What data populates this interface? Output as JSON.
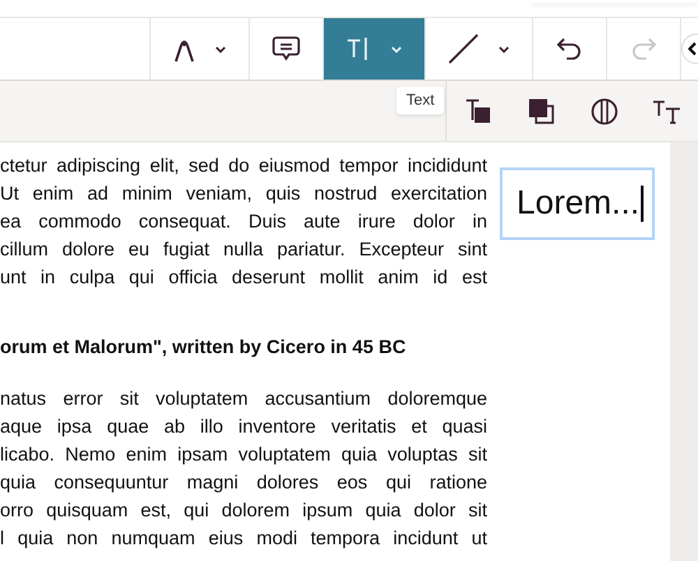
{
  "toolbar": {
    "tools": [
      {
        "kind": "pen",
        "has_caret": true,
        "selected": false,
        "disabled": false
      },
      {
        "kind": "comment",
        "has_caret": false,
        "selected": false,
        "disabled": false
      },
      {
        "kind": "text",
        "has_caret": true,
        "selected": true,
        "disabled": false
      },
      {
        "kind": "line",
        "has_caret": true,
        "selected": false,
        "disabled": false
      },
      {
        "kind": "undo",
        "has_caret": false,
        "selected": false,
        "disabled": false
      },
      {
        "kind": "redo",
        "has_caret": false,
        "selected": false,
        "disabled": true
      }
    ]
  },
  "tooltip": {
    "text": "Text"
  },
  "format_tools": [
    {
      "kind": "text-background"
    },
    {
      "kind": "fill"
    },
    {
      "kind": "contrast"
    },
    {
      "kind": "text-size"
    }
  ],
  "document": {
    "paragraph_1": [
      "ctetur adipiscing elit, sed do eiusmod tempor incididunt",
      "Ut enim ad minim veniam, quis nostrud exercitation",
      "ea commodo consequat. Duis aute irure dolor in",
      "cillum dolore eu fugiat nulla pariatur. Excepteur sint",
      "unt in culpa qui officia deserunt mollit anim id est"
    ],
    "heading": "orum et Malorum\", written by Cicero in 45 BC",
    "paragraph_2": [
      "natus error sit voluptatem accusantium doloremque",
      "aque ipsa quae ab illo inventore veritatis et quasi",
      "licabo. Nemo enim ipsam voluptatem quia voluptas sit",
      "quia consequuntur magni dolores eos qui ratione",
      "orro quisquam est, qui dolorem ipsum quia dolor sit",
      "l quia non numquam eius modi tempora incidunt ut"
    ]
  },
  "text_box": {
    "value": "Lorem..."
  }
}
